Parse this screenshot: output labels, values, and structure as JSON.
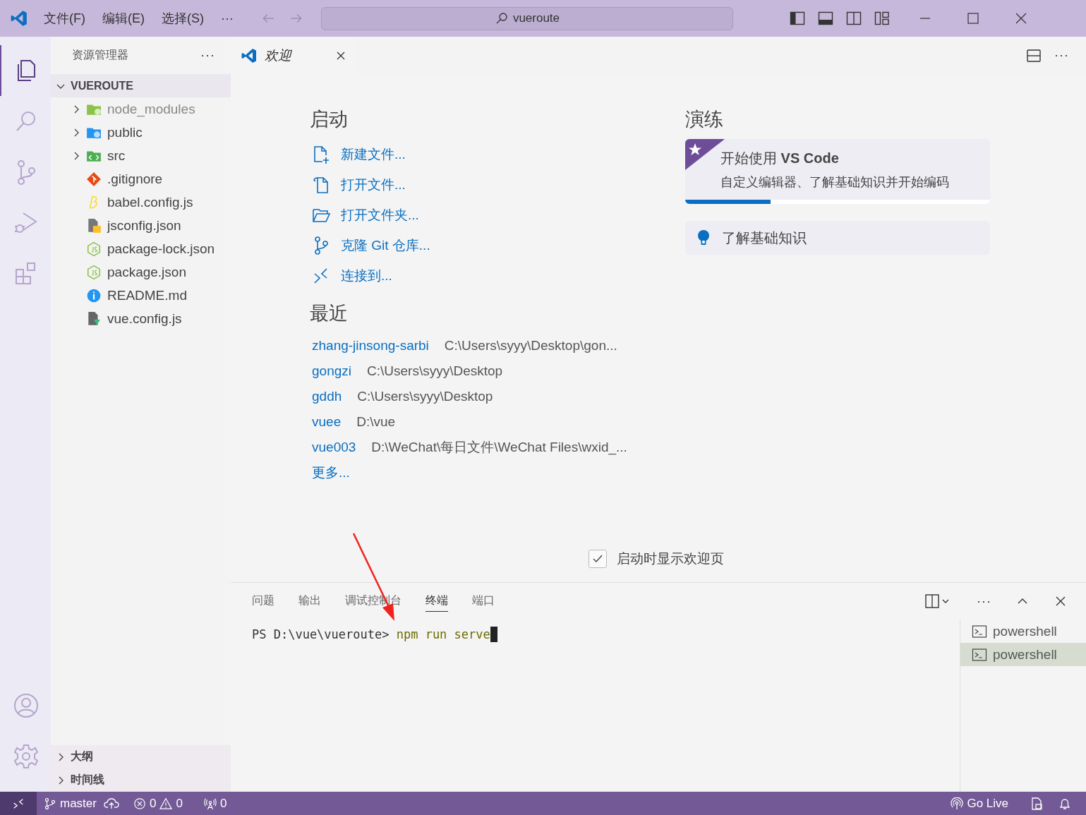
{
  "title_bar": {
    "menus": [
      "文件(F)",
      "编辑(E)",
      "选择(S)",
      "···"
    ],
    "search": "vueroute"
  },
  "activity_bar": {
    "items": [
      {
        "kind": "explorer",
        "selected": true
      },
      {
        "kind": "search",
        "selected": false
      },
      {
        "kind": "scm",
        "selected": false
      },
      {
        "kind": "debug",
        "selected": false
      },
      {
        "kind": "extensions",
        "selected": false
      }
    ],
    "bottom": [
      {
        "kind": "account"
      },
      {
        "kind": "settings"
      }
    ]
  },
  "sidebar": {
    "title": "资源管理器",
    "more": "···",
    "root": {
      "label": "VUEROUTE",
      "expanded": true,
      "children": [
        {
          "label": "node_modules",
          "kind": "node-folder",
          "expanded": false,
          "dimmed": true
        },
        {
          "label": "public",
          "kind": "public-folder",
          "expanded": false,
          "dimmed": false
        },
        {
          "label": "src",
          "kind": "src-folder",
          "expanded": false,
          "dimmed": false
        },
        {
          "label": ".gitignore",
          "kind": "git",
          "dimmed": false
        },
        {
          "label": "babel.config.js",
          "kind": "babel",
          "dimmed": false
        },
        {
          "label": "jsconfig.json",
          "kind": "jsconfig",
          "dimmed": false
        },
        {
          "label": "package-lock.json",
          "kind": "npm",
          "dimmed": false
        },
        {
          "label": "package.json",
          "kind": "npm",
          "dimmed": false
        },
        {
          "label": "README.md",
          "kind": "info",
          "dimmed": false
        },
        {
          "label": "vue.config.js",
          "kind": "vueconfig",
          "dimmed": false
        }
      ]
    },
    "sections": [
      {
        "label": "大纲",
        "expanded": false
      },
      {
        "label": "时间线",
        "expanded": false
      }
    ]
  },
  "editor": {
    "tabs": [
      {
        "label": "欢迎",
        "selected": true
      }
    ],
    "welcome": {
      "start": {
        "title": "启动",
        "actions": [
          {
            "kind": "new-file",
            "label": "新建文件..."
          },
          {
            "kind": "open-file",
            "label": "打开文件..."
          },
          {
            "kind": "open-folder",
            "label": "打开文件夹..."
          },
          {
            "kind": "clone",
            "label": "克隆 Git 仓库..."
          },
          {
            "kind": "connect",
            "label": "连接到..."
          }
        ]
      },
      "recent": {
        "title": "最近",
        "items": [
          {
            "name": "zhang-jinsong-sarbi",
            "path": "C:\\Users\\syyy\\Desktop\\gon..."
          },
          {
            "name": "gongzi",
            "path": "C:\\Users\\syyy\\Desktop"
          },
          {
            "name": "gddh",
            "path": "C:\\Users\\syyy\\Desktop"
          },
          {
            "name": "vuee",
            "path": "D:\\vue"
          },
          {
            "name": "vue003",
            "path": "D:\\WeChat\\每日文件\\WeChat Files\\wxid_..."
          }
        ],
        "more": "更多..."
      },
      "walkthroughs": {
        "title": "演练",
        "items": [
          {
            "kind": "featured",
            "title": "开始使用 **VS Code**",
            "description": "自定义编辑器、了解基础知识并开始编码",
            "level": 0.28
          },
          {
            "kind": "basic",
            "title": "了解基础知识"
          }
        ]
      },
      "show_on_startup": {
        "label": "启动时显示欢迎页",
        "checked": true
      }
    }
  },
  "panel": {
    "tabs": [
      {
        "label": "问题",
        "selected": false
      },
      {
        "label": "输出",
        "selected": false
      },
      {
        "label": "调试控制台",
        "selected": false
      },
      {
        "label": "终端",
        "selected": true
      },
      {
        "label": "端口",
        "selected": false
      }
    ],
    "terminal": {
      "prompt": "PS D:\\vue\\vueroute>",
      "command": "npm run serve"
    },
    "terminals": [
      {
        "label": "powershell",
        "selected": false
      },
      {
        "label": "powershell",
        "selected": true
      }
    ]
  },
  "status_bar": {
    "branch": "master",
    "errors": "0",
    "warnings": "0",
    "ports": "0",
    "go_live": "Go Live"
  }
}
